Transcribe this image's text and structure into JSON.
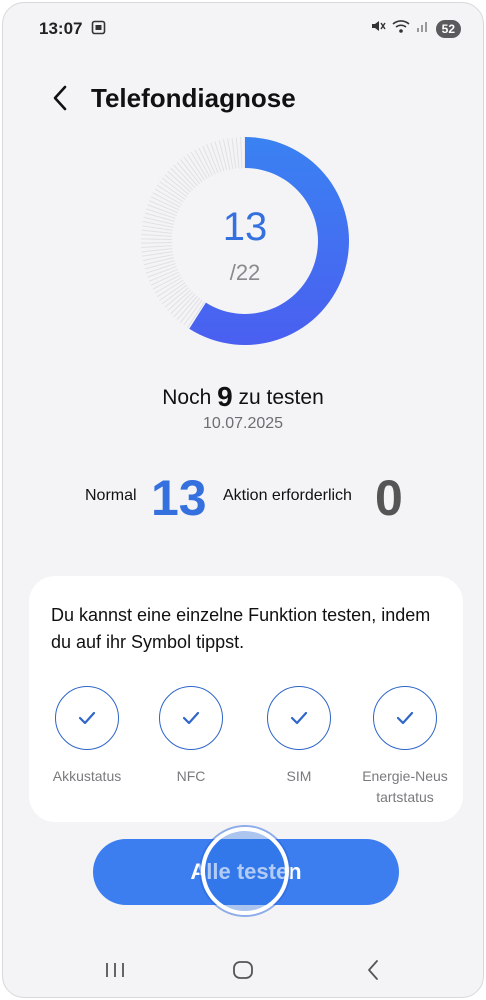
{
  "status_bar": {
    "time": "13:07",
    "battery": "52"
  },
  "header": {
    "title": "Telefondiagnose"
  },
  "summary": {
    "tested": 13,
    "tested_label": "13",
    "total_label": "/22",
    "progress_fraction": 0.59,
    "remaining_prefix": "Noch",
    "remaining_count": "9",
    "remaining_suffix": "zu testen",
    "date": "10.07.2025"
  },
  "stats": {
    "normal_label": "Normal",
    "normal_count": "13",
    "action_label": "Aktion erforderlich",
    "action_count": "0"
  },
  "card": {
    "hint": "Du kannst eine einzelne Funktion testen, indem du auf ihr Symbol tippst.",
    "functions": [
      {
        "label": "Akkustatus"
      },
      {
        "label": "NFC"
      },
      {
        "label": "SIM"
      },
      {
        "label": "Energie-Neus tartstatus"
      }
    ]
  },
  "actions": {
    "test_all": "Alle testen"
  },
  "colors": {
    "accent": "#3c7ef0",
    "progress_start": "#3a82f2",
    "progress_end": "#4a5ff0",
    "normal_count": "#3570df",
    "action_count": "#555555"
  }
}
